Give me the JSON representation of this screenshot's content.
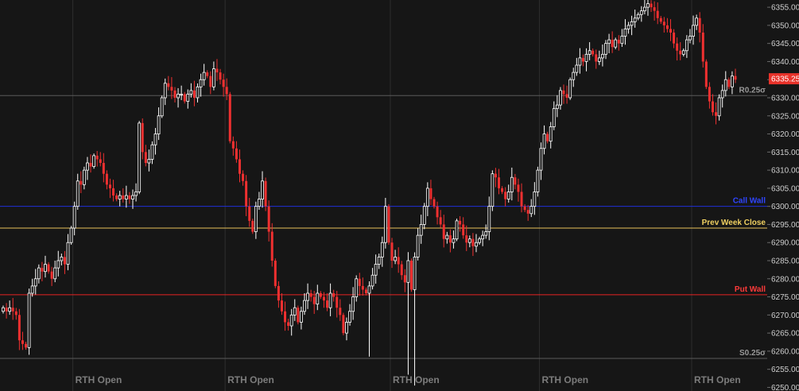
{
  "colors": {
    "background": "#161616",
    "grid": "#2e2e2e",
    "up_candle": "#ffffff",
    "down_candle": "#f03030",
    "price_badge": "#e8322a",
    "axis_text": "#cfcfcf",
    "session_text": "#7c7c7c"
  },
  "chart_data": {
    "type": "candlestick",
    "instrument_timeframe": "intraday",
    "y_axis": {
      "side": "right",
      "range": [
        6249,
        6357
      ],
      "ticks": [
        "6355.00",
        "6350.00",
        "6345.00",
        "6340.00",
        "6335.00",
        "6330.00",
        "6325.00",
        "6320.00",
        "6315.00",
        "6310.00",
        "6305.00",
        "6300.00",
        "6295.00",
        "6290.00",
        "6285.00",
        "6280.00",
        "6275.00",
        "6270.00",
        "6265.00",
        "6260.00",
        "6255.00",
        "6250.00"
      ]
    },
    "last_price": "6335.25",
    "levels": [
      {
        "label": "R0.25σ",
        "value": 6330.6,
        "color": "#5a5a5a",
        "label_color": "#9a9a9a"
      },
      {
        "label": "Call Wall",
        "value": 6300.0,
        "color": "#1f2fd8",
        "label_color": "#2f45ff"
      },
      {
        "label": "Prev Week Close",
        "value": 6294.0,
        "color": "#e8c15a",
        "label_color": "#f0d060"
      },
      {
        "label": "Put Wall",
        "value": 6275.6,
        "color": "#e82424",
        "label_color": "#ff3a3a"
      },
      {
        "label": "S0.25σ",
        "value": 6258.0,
        "color": "#5a5a5a",
        "label_color": "#9a9a9a"
      }
    ],
    "sessions": [
      "RTH Open",
      "RTH Open",
      "RTH Open",
      "RTH Open",
      "RTH Open"
    ],
    "session_bar_index": [
      22,
      69,
      120,
      166,
      213
    ],
    "closes": [
      6272,
      6271,
      6272,
      6271,
      6270,
      6263,
      6262,
      6261,
      6276,
      6278,
      6280,
      6283,
      6282,
      6284,
      6282,
      6280,
      6283,
      6285,
      6286,
      6284,
      6290,
      6294,
      6300,
      6307,
      6306,
      6310,
      6312,
      6311,
      6314,
      6313,
      6312,
      6309,
      6306,
      6305,
      6303,
      6302,
      6303,
      6302,
      6303,
      6302,
      6303,
      6304,
      6323,
      6315,
      6312,
      6313,
      6317,
      6320,
      6325,
      6330,
      6334,
      6333,
      6332,
      6330,
      6331,
      6331,
      6329,
      6331,
      6332,
      6330,
      6333,
      6335,
      6337,
      6336,
      6333,
      6338,
      6337,
      6335,
      6333,
      6331,
      6318,
      6316,
      6313,
      6309,
      6307,
      6300,
      6296,
      6293,
      6300,
      6302,
      6307,
      6300,
      6293,
      6285,
      6278,
      6274,
      6271,
      6268,
      6267,
      6270,
      6272,
      6268,
      6271,
      6274,
      6276,
      6275,
      6273,
      6276,
      6275,
      6274,
      6272,
      6276,
      6275,
      6272,
      6270,
      6265,
      6268,
      6271,
      6275,
      6280,
      6278,
      6277,
      6276,
      6278,
      6281,
      6284,
      6286,
      6290,
      6300,
      6290,
      6285,
      6286,
      6284,
      6281,
      6279,
      6285,
      6277,
      6286,
      6292,
      6295,
      6300,
      6305,
      6302,
      6300,
      6297,
      6295,
      6291,
      6292,
      6290,
      6291,
      6296,
      6295,
      6292,
      6290,
      6291,
      6289,
      6290,
      6291,
      6292,
      6293,
      6300,
      6309,
      6308,
      6305,
      6304,
      6302,
      6304,
      6308,
      6306,
      6304,
      6300,
      6299,
      6298,
      6300,
      6304,
      6310,
      6316,
      6320,
      6318,
      6322,
      6327,
      6328,
      6332,
      6331,
      6330,
      6335,
      6337,
      6339,
      6341,
      6340,
      6342,
      6343,
      6342,
      6340,
      6341,
      6342,
      6345,
      6346,
      6344,
      6346,
      6345,
      6347,
      6349,
      6350,
      6351,
      6352,
      6353,
      6354,
      6355,
      6356,
      6355,
      6354,
      6352,
      6351,
      6350,
      6349,
      6348,
      6345,
      6343,
      6342,
      6343,
      6346,
      6347,
      6350,
      6352,
      6348,
      6340,
      6333,
      6329,
      6326,
      6325,
      6330,
      6332,
      6335,
      6333,
      6336,
      6335
    ]
  }
}
